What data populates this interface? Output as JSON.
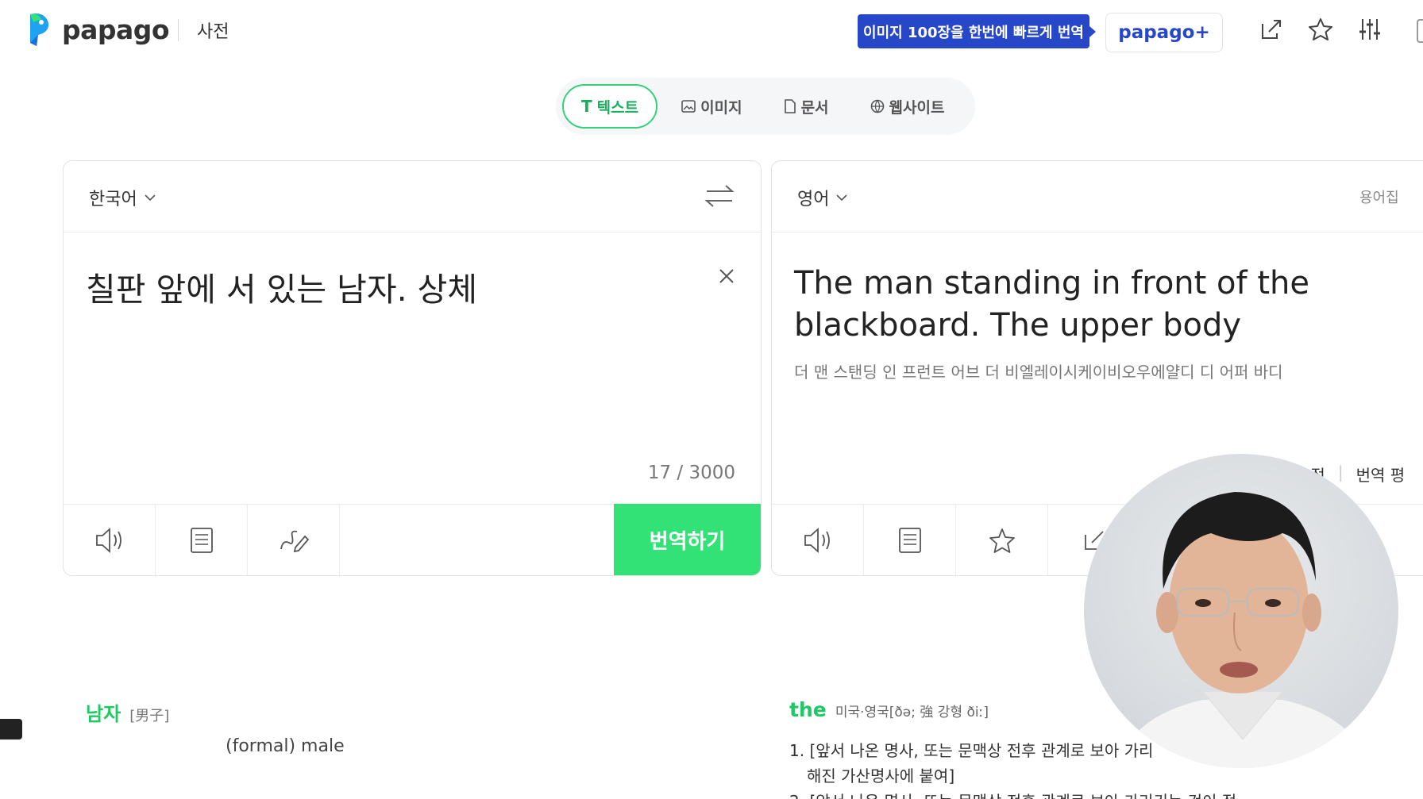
{
  "header": {
    "logo_text": "papago",
    "dict_link": "사전",
    "promo_text": "이미지 100장을 한번에 빠르게 번역",
    "plus_label": "papago+"
  },
  "mode_tabs": [
    {
      "label": "텍스트",
      "icon": "text-icon"
    },
    {
      "label": "이미지",
      "icon": "image-icon"
    },
    {
      "label": "문서",
      "icon": "document-icon"
    },
    {
      "label": "웹사이트",
      "icon": "globe-icon"
    }
  ],
  "source": {
    "language": "한국어",
    "text": "칠판 앞에 서 있는 남자. 상체",
    "count": "17 / 3000",
    "translate_label": "번역하기"
  },
  "target": {
    "language": "영어",
    "glossary_label": "용어집",
    "text": "The man standing in front of the blackboard. The upper body",
    "pronunciation": "더 맨 스탠딩 인 프런트 어브 더 비엘레이시케이비오우에얄디 디 어퍼 바디",
    "link1": "수정",
    "link2": "번역 평"
  },
  "dictionary": {
    "left": {
      "word": "남자",
      "hanja": "[男子]",
      "meaning": "(formal) male"
    },
    "right": {
      "word": "the",
      "pron": "미국·영국[ðə; 強 강형 ðiː]",
      "def1": "1. [앞서 나온 명사, 또는 문맥상 전후 관계로 보아 가리",
      "def1_cont": "해진 가산명사에 붙여]",
      "def2": "2. [앞서 나온 명사, 또는 문맥상 전후 관계로 보아 가리키는 것이 정"
    }
  },
  "colors": {
    "accent_green": "#33e276",
    "brand_blue": "#2747c9"
  }
}
